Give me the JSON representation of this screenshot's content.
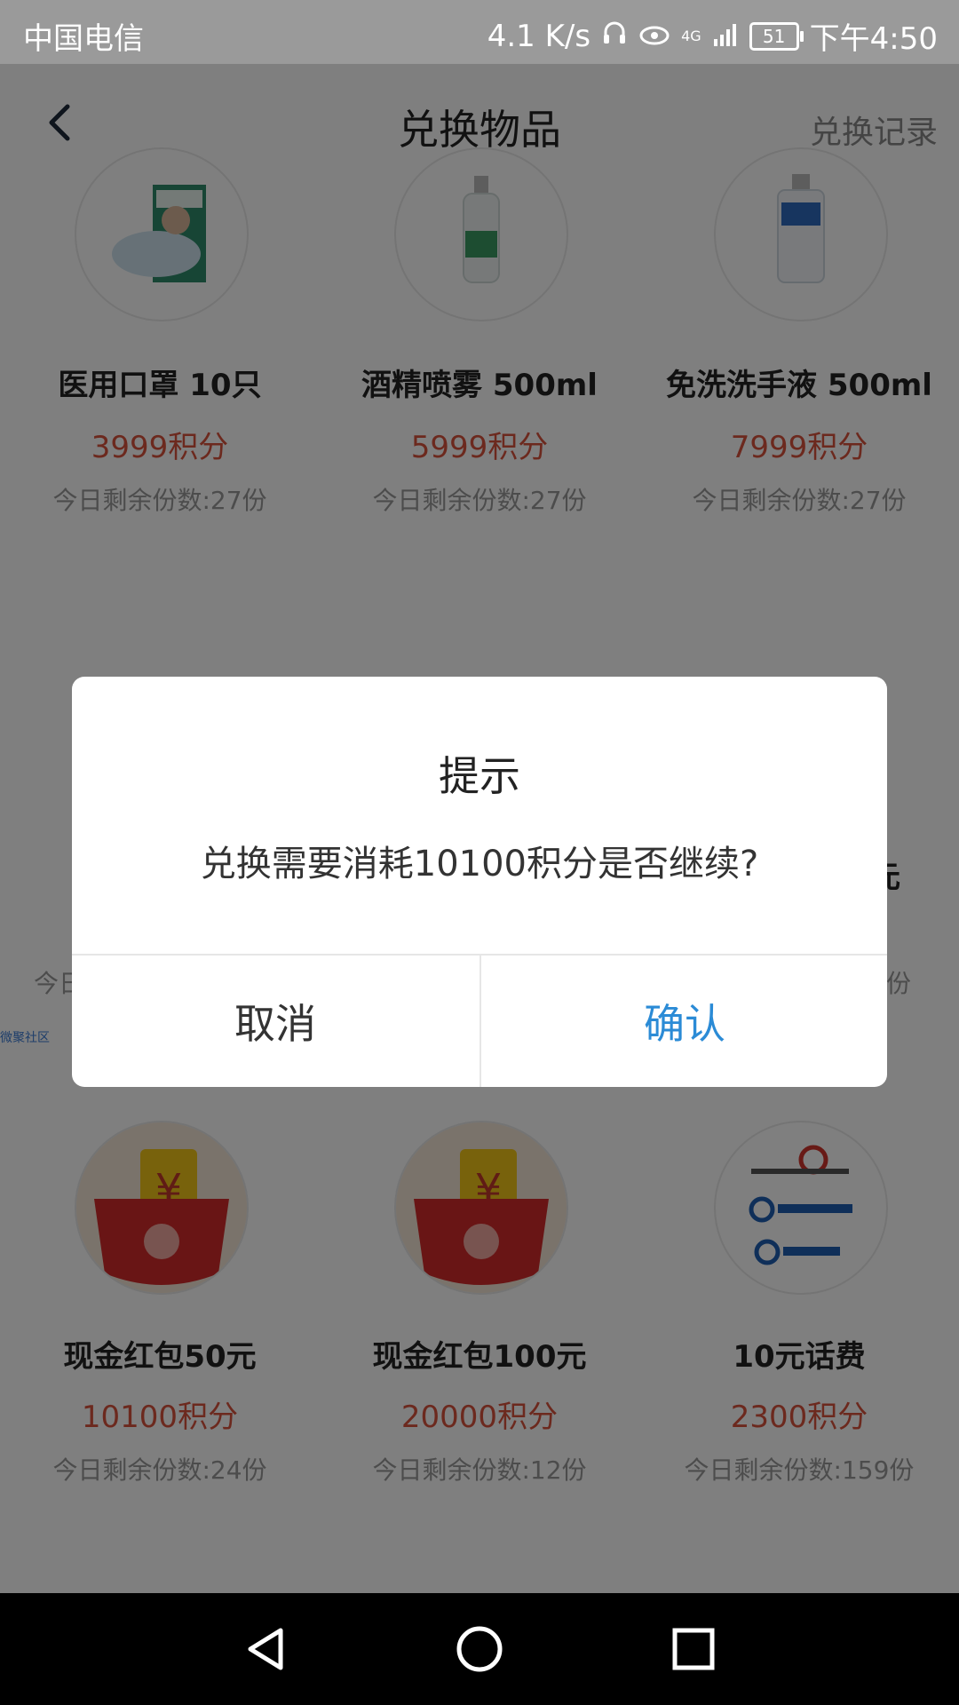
{
  "status": {
    "carrier": "中国电信",
    "speed": "4.1 K/s",
    "network": "4G",
    "battery": "51",
    "time": "下午4:50"
  },
  "header": {
    "title": "兑换物品",
    "history": "兑换记录"
  },
  "items": [
    {
      "name": "医用口罩 10只",
      "price": "3999积分",
      "stock": "今日剩余份数:27份",
      "icon": "mask-box-icon"
    },
    {
      "name": "酒精喷雾 500ml",
      "price": "5999积分",
      "stock": "今日剩余份数:27份",
      "icon": "alcohol-spray-icon"
    },
    {
      "name": "免洗洗手液 500ml",
      "price": "7999积分",
      "stock": "今日剩余份数:27份",
      "icon": "hand-sanitizer-icon"
    },
    {
      "name": "现金红包50元",
      "price": "10100积分",
      "stock": "今日剩余份数:24份",
      "icon": "red-envelope-icon"
    },
    {
      "name": "现金红包100元",
      "price": "20000积分",
      "stock": "今日剩余份数:12份",
      "icon": "red-envelope-icon"
    },
    {
      "name": "10元话费",
      "price": "2300积分",
      "stock": "今日剩余份数:159份",
      "icon": "carrier-logos-icon"
    }
  ],
  "partial": {
    "left_stock": "今日",
    "right_name": "元",
    "right_stock": "份",
    "side_tag": "微聚社区"
  },
  "dialog": {
    "title": "提示",
    "message": "兑换需要消耗10100积分是否继续?",
    "cancel": "取消",
    "confirm": "确认"
  },
  "colors": {
    "price": "#d9533d",
    "confirm": "#2b8bd6",
    "status_bar": "#9a9a9a"
  }
}
